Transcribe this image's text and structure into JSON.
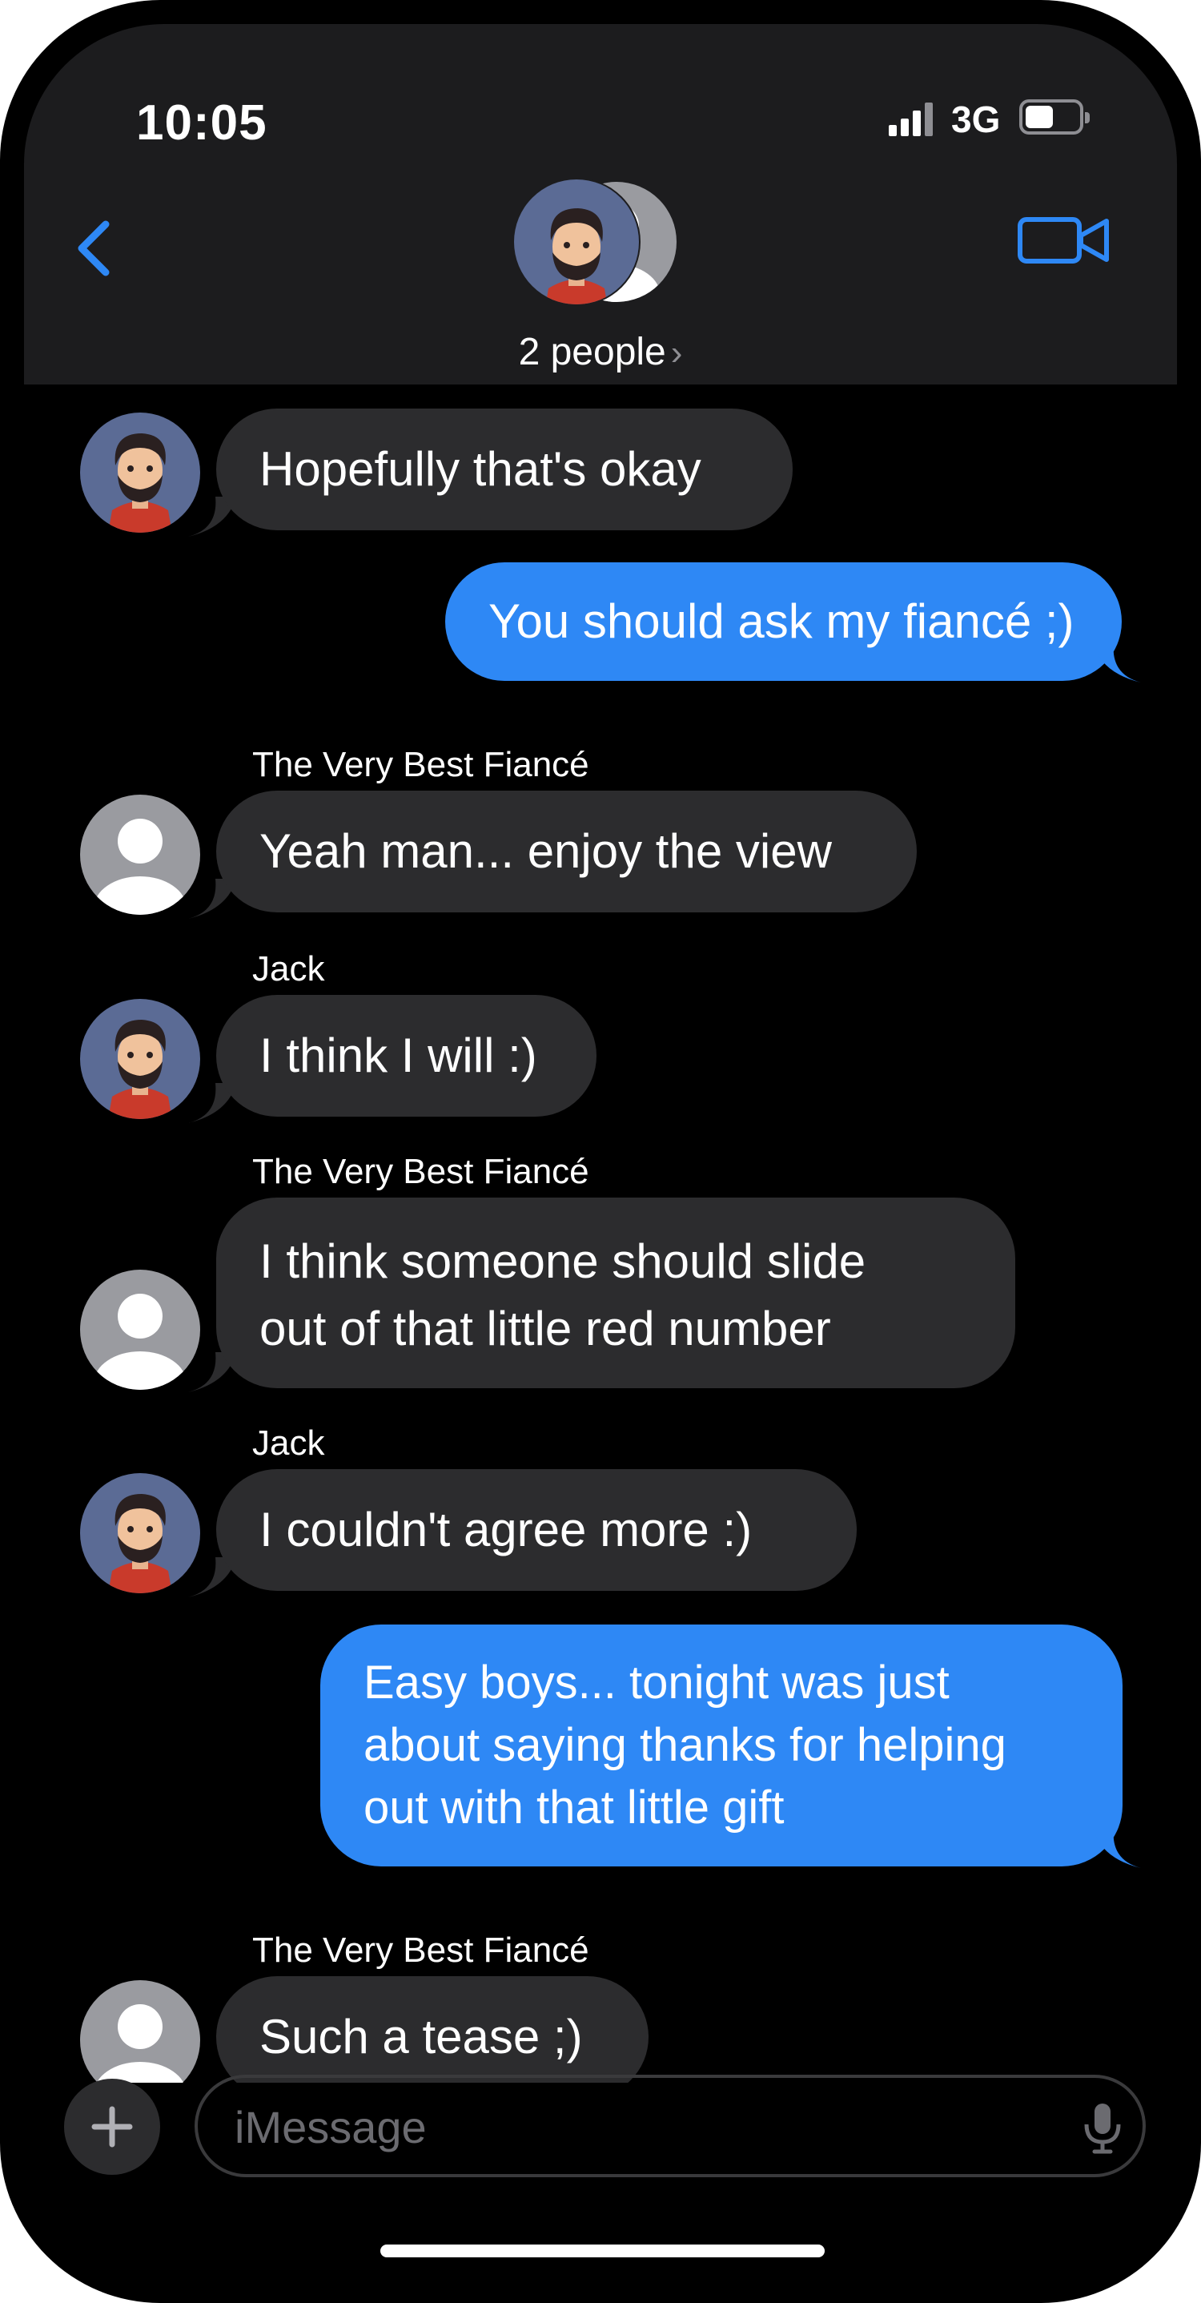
{
  "status_bar": {
    "time": "10:05",
    "network": "3G"
  },
  "header": {
    "group_label": "2 people",
    "group_chevron": "›"
  },
  "messages": [
    {
      "direction": "incoming",
      "sender": "",
      "text": "Hopefully that's okay"
    },
    {
      "direction": "outgoing",
      "sender": "",
      "text": "You should ask my fiancé ;)"
    },
    {
      "direction": "incoming",
      "sender": "The Very Best Fiancé",
      "text": "Yeah man... enjoy the view"
    },
    {
      "direction": "incoming",
      "sender": "Jack",
      "text": "I think I will :)"
    },
    {
      "direction": "incoming",
      "sender": "The Very Best Fiancé",
      "text": "I think someone should slide out of that little red number",
      "lines": [
        "I think someone should slide",
        "out of that little red number"
      ]
    },
    {
      "direction": "incoming",
      "sender": "Jack",
      "text": "I couldn't agree more :)"
    },
    {
      "direction": "outgoing",
      "sender": "",
      "text": "Easy boys... tonight was just about saying thanks for helping out with that little gift",
      "lines": [
        "Easy boys... tonight was just",
        "about saying thanks for helping",
        "out with that little gift"
      ]
    },
    {
      "direction": "incoming",
      "sender": "The Very Best Fiancé",
      "text": "Such a tease ;)"
    }
  ],
  "composer": {
    "placeholder": "iMessage"
  },
  "icons": {
    "back": "chevron-left-icon",
    "video": "video-camera-icon",
    "add": "plus-icon",
    "mic": "microphone-icon"
  },
  "colors": {
    "accent": "#2e88f5",
    "incoming_bubble": "#2c2c2e",
    "header_bg": "#1c1c1e",
    "background": "#000000"
  }
}
